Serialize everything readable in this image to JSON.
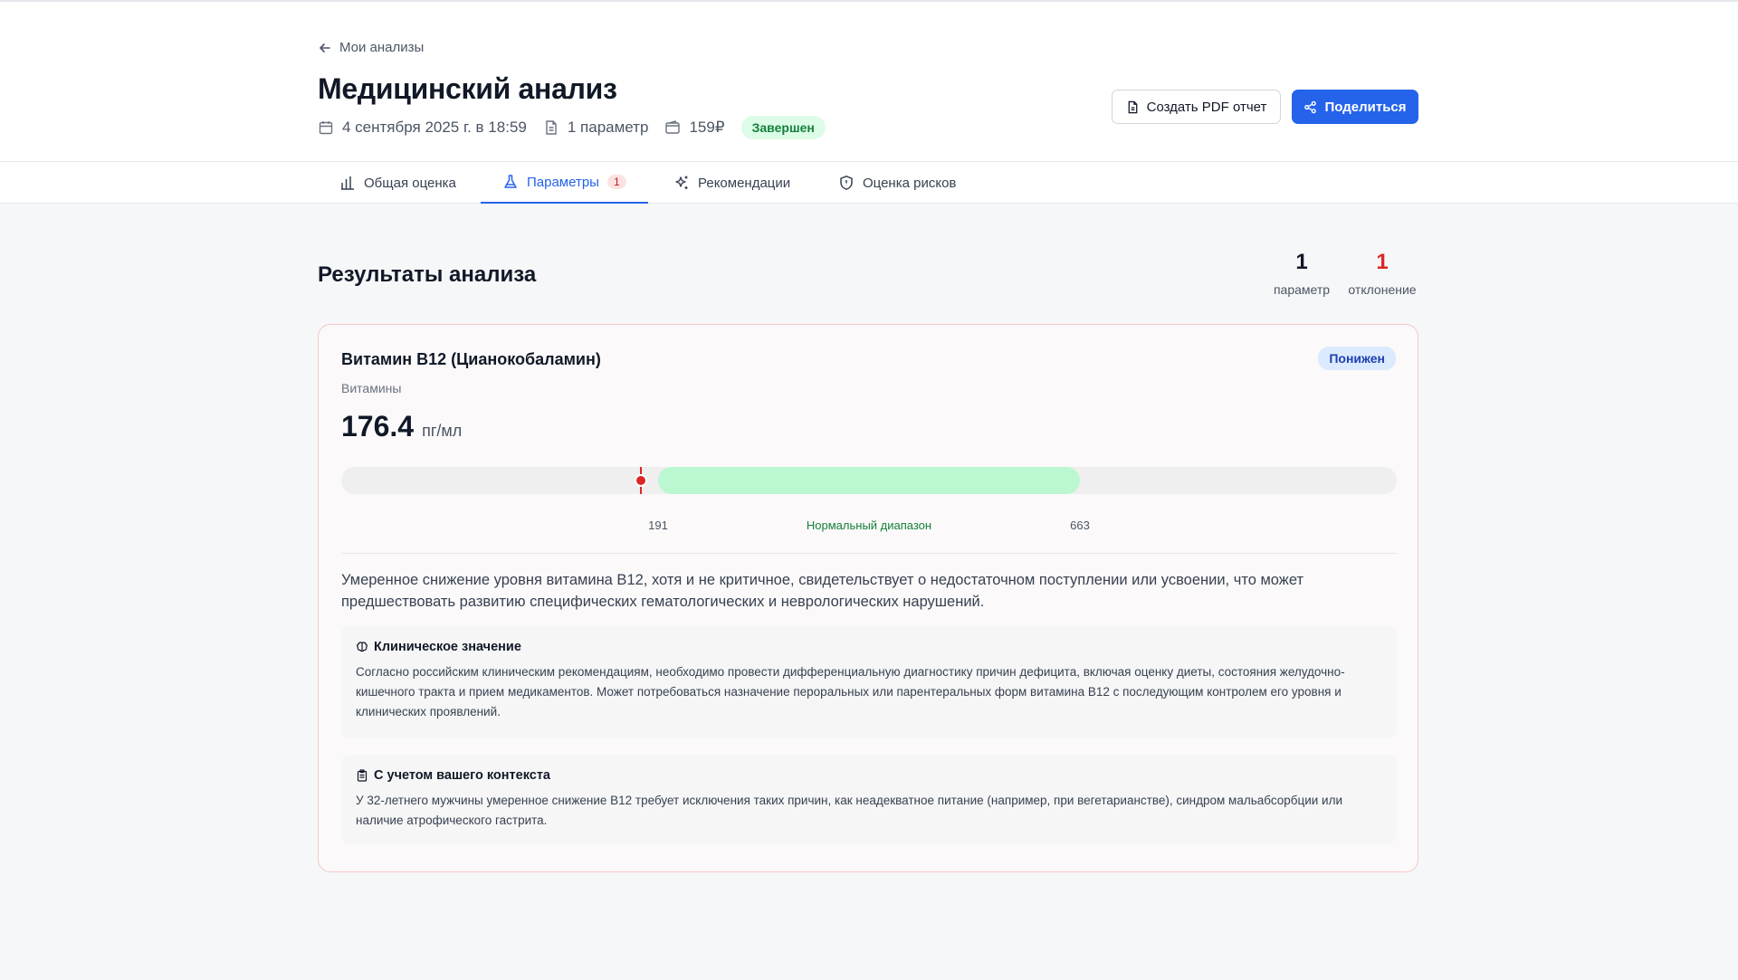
{
  "header": {
    "back_label": "Мои анализы",
    "title": "Медицинский анализ",
    "meta": {
      "date": "4 сентября 2025 г. в 18:59",
      "params": "1 параметр",
      "price": "159₽",
      "status": "Завершен"
    },
    "pdf_button": "Создать PDF отчет",
    "share_button": "Поделиться"
  },
  "tabs": [
    {
      "label": "Общая оценка",
      "icon": "bar-chart-icon"
    },
    {
      "label": "Параметры",
      "icon": "flask-icon",
      "badge": "1",
      "active": true
    },
    {
      "label": "Рекомендации",
      "icon": "sparkles-icon"
    },
    {
      "label": "Оценка рисков",
      "icon": "shield-icon"
    }
  ],
  "results": {
    "title": "Результаты анализа",
    "stats": [
      {
        "value": "1",
        "label": "параметр"
      },
      {
        "value": "1",
        "label": "отклонение"
      }
    ]
  },
  "parameter": {
    "name": "Витамин B12 (Цианокобаламин)",
    "category": "Витамины",
    "status": "Понижен",
    "value": "176.4",
    "unit": "пг/мл",
    "range": {
      "low": "191",
      "high": "663",
      "label": "Нормальный диапазон"
    },
    "summary": "Умеренное снижение уровня витамина B12, хотя и не критичное, свидетельствует о недостаточном поступлении или усвоении, что может предшествовать развитию специфических гематологических и неврологических нарушений.",
    "clinical": {
      "title": "Клиническое значение",
      "text": "Согласно российским клиническим рекомендациям, необходимо провести дифференциальную диагностику причин дефицита, включая оценку диеты, состояния желудочно-кишечного тракта и прием медикаментов. Может потребоваться назначение пероральных или парентеральных форм витамина B12 с последующим контролем его уровня и клинических проявлений."
    },
    "context": {
      "title": "С учетом вашего контекста",
      "text": "У 32-летнего мужчины умеренное снижение B12 требует исключения таких причин, как неадекватное питание (например, при вегетарианстве), синдром мальабсорбции или наличие атрофического гастрита."
    }
  },
  "colors": {
    "accent": "#2563eb",
    "deviation": "#dc2626",
    "normal_range": "#bbf7d0",
    "status_done": "#15803d"
  }
}
